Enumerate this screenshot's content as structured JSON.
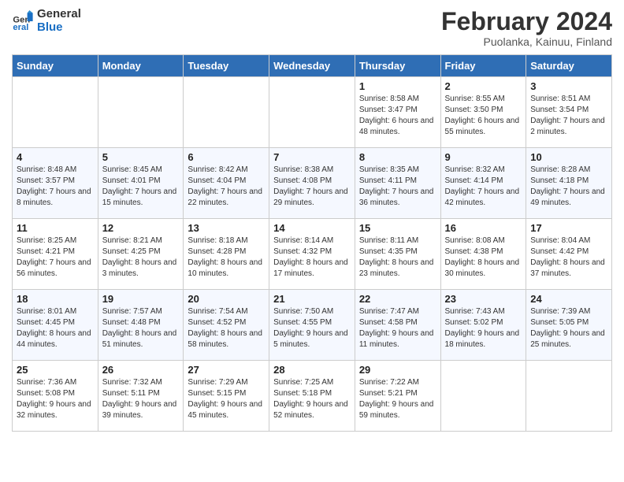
{
  "header": {
    "logo_line1": "General",
    "logo_line2": "Blue",
    "title": "February 2024",
    "subtitle": "Puolanka, Kainuu, Finland"
  },
  "days_of_week": [
    "Sunday",
    "Monday",
    "Tuesday",
    "Wednesday",
    "Thursday",
    "Friday",
    "Saturday"
  ],
  "weeks": [
    [
      {
        "day": "",
        "sunrise": "",
        "sunset": "",
        "daylight": ""
      },
      {
        "day": "",
        "sunrise": "",
        "sunset": "",
        "daylight": ""
      },
      {
        "day": "",
        "sunrise": "",
        "sunset": "",
        "daylight": ""
      },
      {
        "day": "",
        "sunrise": "",
        "sunset": "",
        "daylight": ""
      },
      {
        "day": "1",
        "sunrise": "Sunrise: 8:58 AM",
        "sunset": "Sunset: 3:47 PM",
        "daylight": "Daylight: 6 hours and 48 minutes."
      },
      {
        "day": "2",
        "sunrise": "Sunrise: 8:55 AM",
        "sunset": "Sunset: 3:50 PM",
        "daylight": "Daylight: 6 hours and 55 minutes."
      },
      {
        "day": "3",
        "sunrise": "Sunrise: 8:51 AM",
        "sunset": "Sunset: 3:54 PM",
        "daylight": "Daylight: 7 hours and 2 minutes."
      }
    ],
    [
      {
        "day": "4",
        "sunrise": "Sunrise: 8:48 AM",
        "sunset": "Sunset: 3:57 PM",
        "daylight": "Daylight: 7 hours and 8 minutes."
      },
      {
        "day": "5",
        "sunrise": "Sunrise: 8:45 AM",
        "sunset": "Sunset: 4:01 PM",
        "daylight": "Daylight: 7 hours and 15 minutes."
      },
      {
        "day": "6",
        "sunrise": "Sunrise: 8:42 AM",
        "sunset": "Sunset: 4:04 PM",
        "daylight": "Daylight: 7 hours and 22 minutes."
      },
      {
        "day": "7",
        "sunrise": "Sunrise: 8:38 AM",
        "sunset": "Sunset: 4:08 PM",
        "daylight": "Daylight: 7 hours and 29 minutes."
      },
      {
        "day": "8",
        "sunrise": "Sunrise: 8:35 AM",
        "sunset": "Sunset: 4:11 PM",
        "daylight": "Daylight: 7 hours and 36 minutes."
      },
      {
        "day": "9",
        "sunrise": "Sunrise: 8:32 AM",
        "sunset": "Sunset: 4:14 PM",
        "daylight": "Daylight: 7 hours and 42 minutes."
      },
      {
        "day": "10",
        "sunrise": "Sunrise: 8:28 AM",
        "sunset": "Sunset: 4:18 PM",
        "daylight": "Daylight: 7 hours and 49 minutes."
      }
    ],
    [
      {
        "day": "11",
        "sunrise": "Sunrise: 8:25 AM",
        "sunset": "Sunset: 4:21 PM",
        "daylight": "Daylight: 7 hours and 56 minutes."
      },
      {
        "day": "12",
        "sunrise": "Sunrise: 8:21 AM",
        "sunset": "Sunset: 4:25 PM",
        "daylight": "Daylight: 8 hours and 3 minutes."
      },
      {
        "day": "13",
        "sunrise": "Sunrise: 8:18 AM",
        "sunset": "Sunset: 4:28 PM",
        "daylight": "Daylight: 8 hours and 10 minutes."
      },
      {
        "day": "14",
        "sunrise": "Sunrise: 8:14 AM",
        "sunset": "Sunset: 4:32 PM",
        "daylight": "Daylight: 8 hours and 17 minutes."
      },
      {
        "day": "15",
        "sunrise": "Sunrise: 8:11 AM",
        "sunset": "Sunset: 4:35 PM",
        "daylight": "Daylight: 8 hours and 23 minutes."
      },
      {
        "day": "16",
        "sunrise": "Sunrise: 8:08 AM",
        "sunset": "Sunset: 4:38 PM",
        "daylight": "Daylight: 8 hours and 30 minutes."
      },
      {
        "day": "17",
        "sunrise": "Sunrise: 8:04 AM",
        "sunset": "Sunset: 4:42 PM",
        "daylight": "Daylight: 8 hours and 37 minutes."
      }
    ],
    [
      {
        "day": "18",
        "sunrise": "Sunrise: 8:01 AM",
        "sunset": "Sunset: 4:45 PM",
        "daylight": "Daylight: 8 hours and 44 minutes."
      },
      {
        "day": "19",
        "sunrise": "Sunrise: 7:57 AM",
        "sunset": "Sunset: 4:48 PM",
        "daylight": "Daylight: 8 hours and 51 minutes."
      },
      {
        "day": "20",
        "sunrise": "Sunrise: 7:54 AM",
        "sunset": "Sunset: 4:52 PM",
        "daylight": "Daylight: 8 hours and 58 minutes."
      },
      {
        "day": "21",
        "sunrise": "Sunrise: 7:50 AM",
        "sunset": "Sunset: 4:55 PM",
        "daylight": "Daylight: 9 hours and 5 minutes."
      },
      {
        "day": "22",
        "sunrise": "Sunrise: 7:47 AM",
        "sunset": "Sunset: 4:58 PM",
        "daylight": "Daylight: 9 hours and 11 minutes."
      },
      {
        "day": "23",
        "sunrise": "Sunrise: 7:43 AM",
        "sunset": "Sunset: 5:02 PM",
        "daylight": "Daylight: 9 hours and 18 minutes."
      },
      {
        "day": "24",
        "sunrise": "Sunrise: 7:39 AM",
        "sunset": "Sunset: 5:05 PM",
        "daylight": "Daylight: 9 hours and 25 minutes."
      }
    ],
    [
      {
        "day": "25",
        "sunrise": "Sunrise: 7:36 AM",
        "sunset": "Sunset: 5:08 PM",
        "daylight": "Daylight: 9 hours and 32 minutes."
      },
      {
        "day": "26",
        "sunrise": "Sunrise: 7:32 AM",
        "sunset": "Sunset: 5:11 PM",
        "daylight": "Daylight: 9 hours and 39 minutes."
      },
      {
        "day": "27",
        "sunrise": "Sunrise: 7:29 AM",
        "sunset": "Sunset: 5:15 PM",
        "daylight": "Daylight: 9 hours and 45 minutes."
      },
      {
        "day": "28",
        "sunrise": "Sunrise: 7:25 AM",
        "sunset": "Sunset: 5:18 PM",
        "daylight": "Daylight: 9 hours and 52 minutes."
      },
      {
        "day": "29",
        "sunrise": "Sunrise: 7:22 AM",
        "sunset": "Sunset: 5:21 PM",
        "daylight": "Daylight: 9 hours and 59 minutes."
      },
      {
        "day": "",
        "sunrise": "",
        "sunset": "",
        "daylight": ""
      },
      {
        "day": "",
        "sunrise": "",
        "sunset": "",
        "daylight": ""
      }
    ]
  ]
}
